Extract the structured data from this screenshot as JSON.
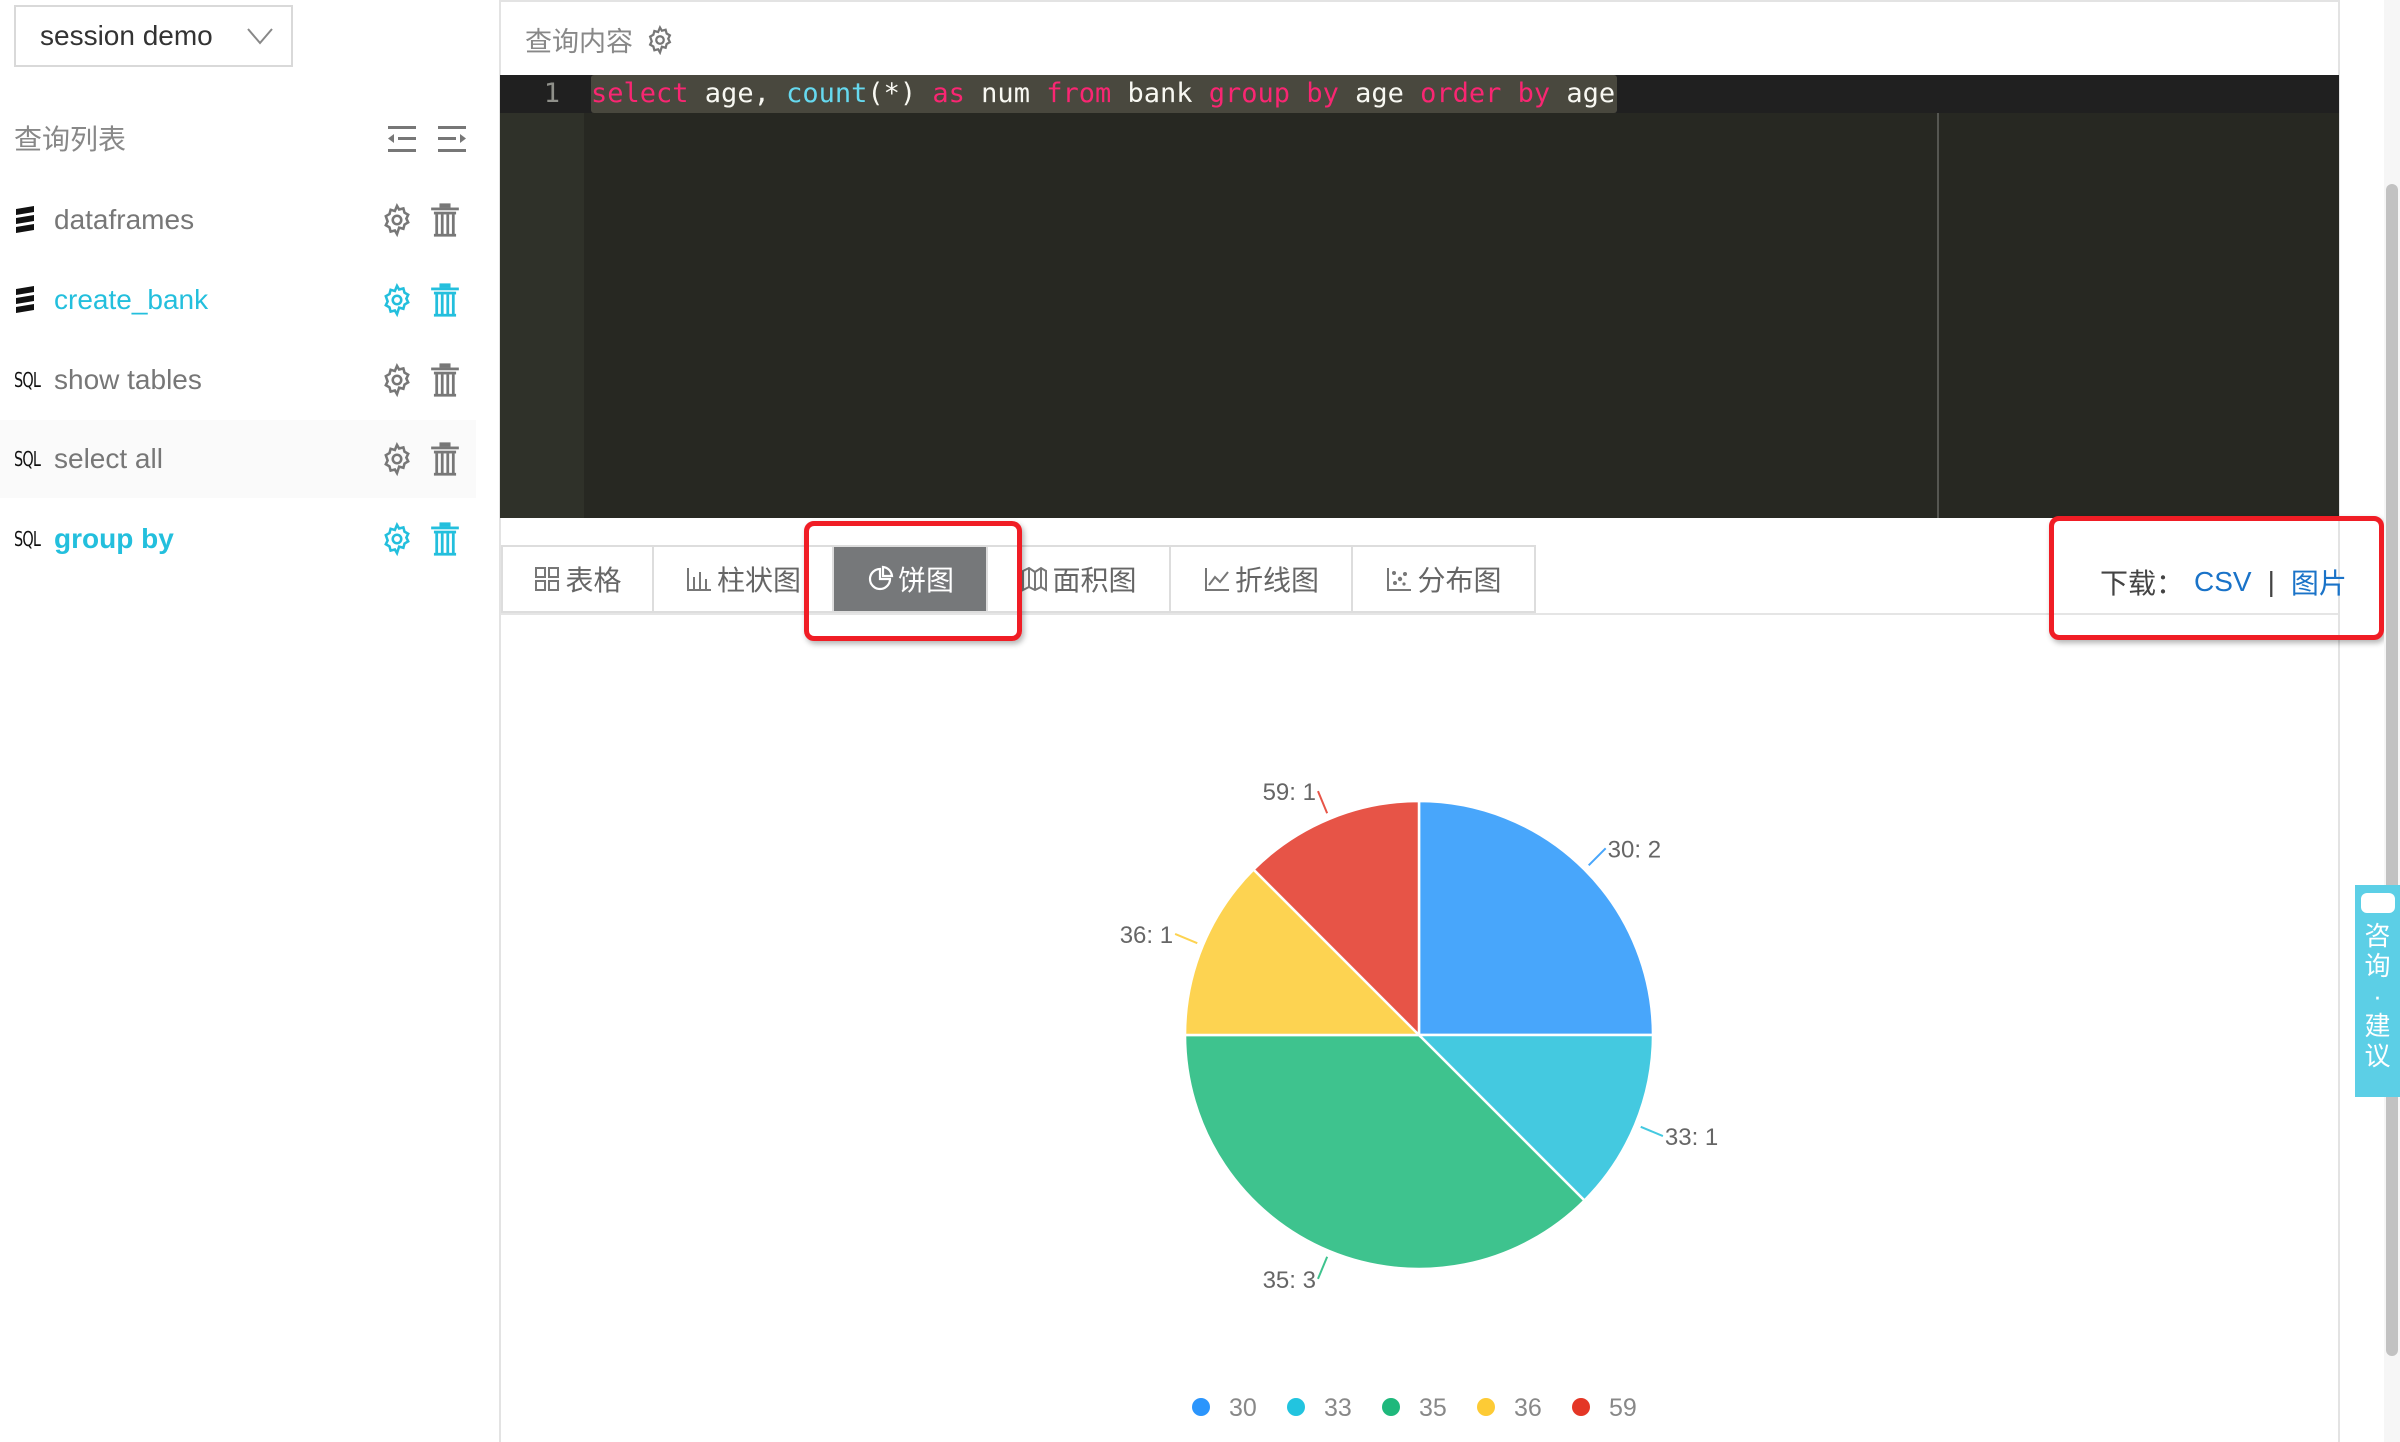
{
  "session": {
    "selected": "session demo"
  },
  "sidebar": {
    "title": "查询列表",
    "items": [
      {
        "type": "dataframe",
        "icon": "stack-icon",
        "label": "dataframes",
        "state": "normal"
      },
      {
        "type": "dataframe",
        "icon": "stack-icon",
        "label": "create_bank",
        "state": "active"
      },
      {
        "type": "sql",
        "icon": "sql-icon",
        "icon_text": "SQL",
        "label": "show tables",
        "state": "normal"
      },
      {
        "type": "sql",
        "icon": "sql-icon",
        "icon_text": "SQL",
        "label": "select all",
        "state": "hover"
      },
      {
        "type": "sql",
        "icon": "sql-icon",
        "icon_text": "SQL",
        "label": "group by",
        "state": "active-bold"
      }
    ]
  },
  "editor": {
    "header": "查询内容",
    "line_number": "1",
    "tokens": [
      {
        "t": "select",
        "c": "kw"
      },
      {
        "t": " age, ",
        "c": ""
      },
      {
        "t": "count",
        "c": "fn"
      },
      {
        "t": "(*) ",
        "c": ""
      },
      {
        "t": "as",
        "c": "kw"
      },
      {
        "t": " num ",
        "c": ""
      },
      {
        "t": "from",
        "c": "kw"
      },
      {
        "t": " bank ",
        "c": ""
      },
      {
        "t": "group by",
        "c": "kw"
      },
      {
        "t": " age ",
        "c": ""
      },
      {
        "t": "order by",
        "c": "kw"
      },
      {
        "t": " age",
        "c": ""
      }
    ]
  },
  "tabs": [
    {
      "label": "表格",
      "icon": "grid-icon",
      "active": false
    },
    {
      "label": "柱状图",
      "icon": "bar-chart-icon",
      "active": false
    },
    {
      "label": "饼图",
      "icon": "pie-chart-icon",
      "active": true
    },
    {
      "label": "面积图",
      "icon": "area-chart-icon",
      "active": false
    },
    {
      "label": "折线图",
      "icon": "line-chart-icon",
      "active": false
    },
    {
      "label": "分布图",
      "icon": "scatter-chart-icon",
      "active": false
    }
  ],
  "download": {
    "label": "下载：",
    "csv": "CSV",
    "separator": "|",
    "image": "图片"
  },
  "float_tab": {
    "chars": [
      "咨",
      "询",
      "·",
      "建",
      "议"
    ]
  },
  "colors": {
    "accent": "#23bfdd",
    "link": "#1a73c8",
    "highlight": "#f01d25"
  },
  "chart_data": {
    "type": "pie",
    "title": "",
    "categories": [
      "30",
      "33",
      "35",
      "36",
      "59"
    ],
    "values": [
      2,
      1,
      3,
      1,
      1
    ],
    "labels": [
      "30: 2",
      "33: 1",
      "35: 3",
      "36: 1",
      "59: 1"
    ],
    "colors": [
      "#48a6fb",
      "#44c9e0",
      "#3ec38e",
      "#fdd351",
      "#e75447"
    ],
    "legend_colors": [
      "#2b95fc",
      "#22c4df",
      "#1fb87c",
      "#fdcb35",
      "#e43626"
    ],
    "legend": {
      "position": "bottom-center"
    }
  }
}
